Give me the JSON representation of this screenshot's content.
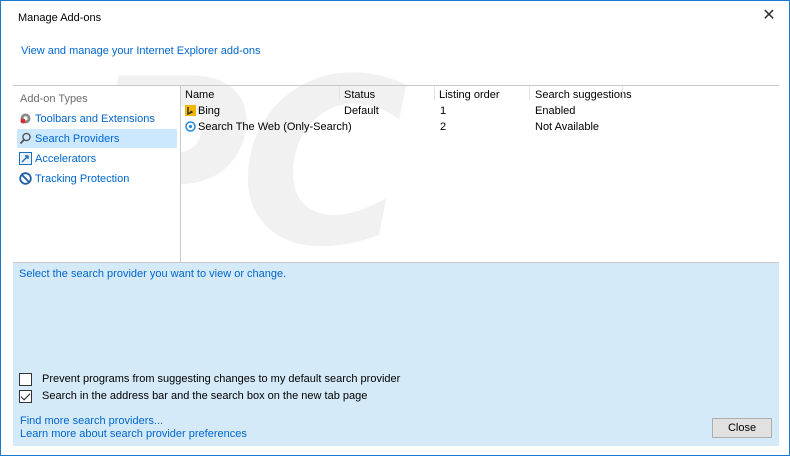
{
  "window": {
    "title": "Manage Add-ons",
    "close_glyph": "✕",
    "subtitle": "View and manage your Internet Explorer add-ons"
  },
  "sidebar": {
    "heading": "Add-on Types",
    "items": [
      {
        "label": "Toolbars and Extensions",
        "icon": "gear-icon",
        "selected": false
      },
      {
        "label": "Search Providers",
        "icon": "search-icon",
        "selected": true
      },
      {
        "label": "Accelerators",
        "icon": "accelerator-icon",
        "selected": false
      },
      {
        "label": "Tracking Protection",
        "icon": "no-entry-icon",
        "selected": false
      }
    ]
  },
  "table": {
    "columns": [
      "Name",
      "Status",
      "Listing order",
      "Search suggestions"
    ],
    "rows": [
      {
        "name": "Bing",
        "icon": "bing-icon",
        "status": "Default",
        "order": "1",
        "suggestions": "Enabled"
      },
      {
        "name": "Search The Web (Only-Search)",
        "icon": "circle-search-icon",
        "status": "",
        "order": "2",
        "suggestions": "Not Available"
      }
    ]
  },
  "details": {
    "hint": "Select the search provider you want to view or change.",
    "checkboxes": [
      {
        "label": "Prevent programs from suggesting changes to my default search provider",
        "checked": false
      },
      {
        "label": "Search in the address bar and the search box on the new tab page",
        "checked": true
      }
    ],
    "links": [
      "Find more search providers...",
      "Learn more about search provider preferences"
    ],
    "close_label": "Close"
  },
  "watermark": "PC risk.com",
  "colors": {
    "accent": "#0066cc",
    "selected": "#cce8ff",
    "details_bg": "#d5eaf8",
    "border": "#1979ca"
  }
}
